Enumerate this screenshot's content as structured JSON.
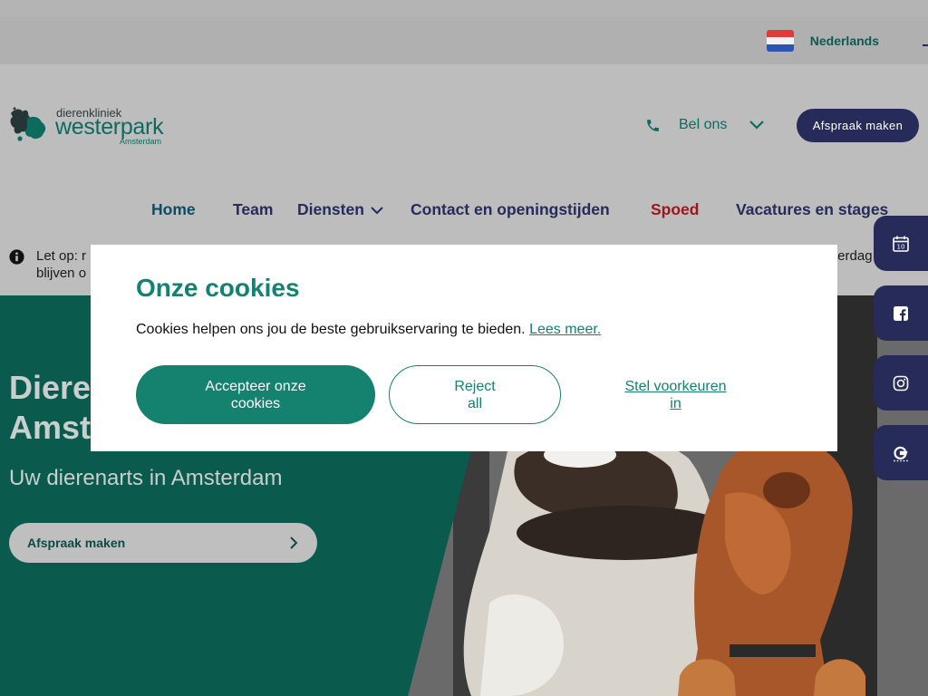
{
  "topbar": {
    "language": "Nederlands",
    "flag_colors": [
      "#e03a3a",
      "#f2f2f2",
      "#2a56b0"
    ]
  },
  "logo": {
    "line1": "dierenkliniek",
    "line2": "westerpark",
    "line3": "Amsterdam"
  },
  "header": {
    "call_label": "Bel ons",
    "appointment_label": "Afspraak maken"
  },
  "nav": {
    "items": [
      {
        "label": "Home"
      },
      {
        "label": "Team"
      },
      {
        "label": "Diensten"
      },
      {
        "label": "Contact en openingstijden"
      },
      {
        "label": "Spoed"
      },
      {
        "label": "Vacatures en stages"
      }
    ]
  },
  "notice": {
    "line1_start": "Let op: r",
    "line1_end": "terdag",
    "line2_start": "blijven o"
  },
  "hero": {
    "title_line1": "Diere",
    "title_line2": "Amst",
    "subtitle": "Uw dierenarts in Amsterdam",
    "button_label": "Afspraak maken"
  },
  "socials": {
    "items": [
      {
        "icon": "calendar-icon",
        "text": "10"
      },
      {
        "icon": "facebook-icon"
      },
      {
        "icon": "instagram-icon"
      },
      {
        "icon": "google-icon"
      }
    ]
  },
  "cookie_modal": {
    "title": "Onze cookies",
    "text": "Cookies helpen ons jou de beste gebruikservaring te bieden.",
    "link": "Lees meer.",
    "accept_label": "Accepteer onze cookies",
    "reject_label": "Reject all",
    "prefs_label": "Stel voorkeuren in"
  },
  "colors": {
    "brand_green": "#14826f",
    "navy": "#262b5a",
    "spoed_red": "#a3141c",
    "overlay_gray": "#bdbdbd"
  }
}
